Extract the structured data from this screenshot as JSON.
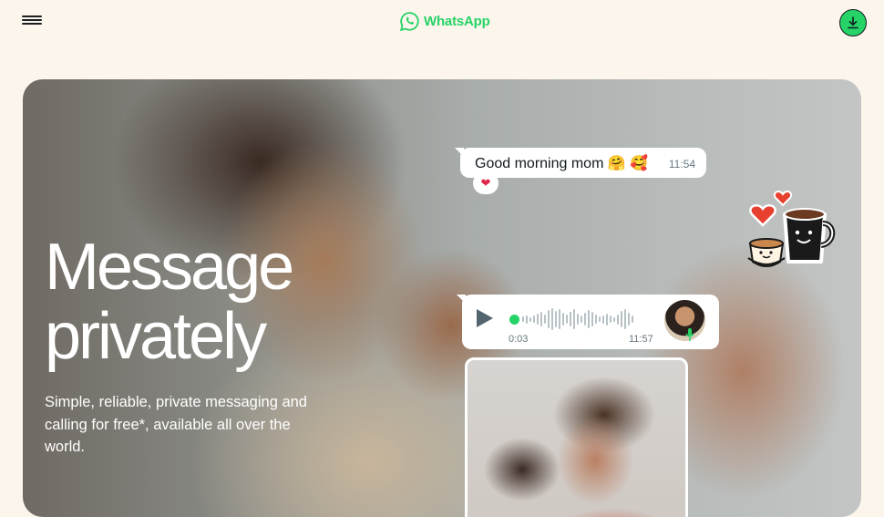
{
  "header": {
    "menu_icon": "hamburger-menu-icon",
    "brand": "WhatsApp",
    "logo_icon": "whatsapp-logo-icon",
    "download_icon": "download-icon"
  },
  "hero": {
    "title_line1": "Message",
    "title_line2": "privately",
    "subtitle": "Simple, reliable, private messaging and calling for free*, available all over the world."
  },
  "chat": {
    "text_message": "Good morning mom 🤗 🥰",
    "text_time": "11:54",
    "reaction": "❤",
    "voice_duration": "0:03",
    "voice_time": "11:57"
  },
  "colors": {
    "brand_green": "#25D366",
    "background": "#FCF5EB"
  }
}
